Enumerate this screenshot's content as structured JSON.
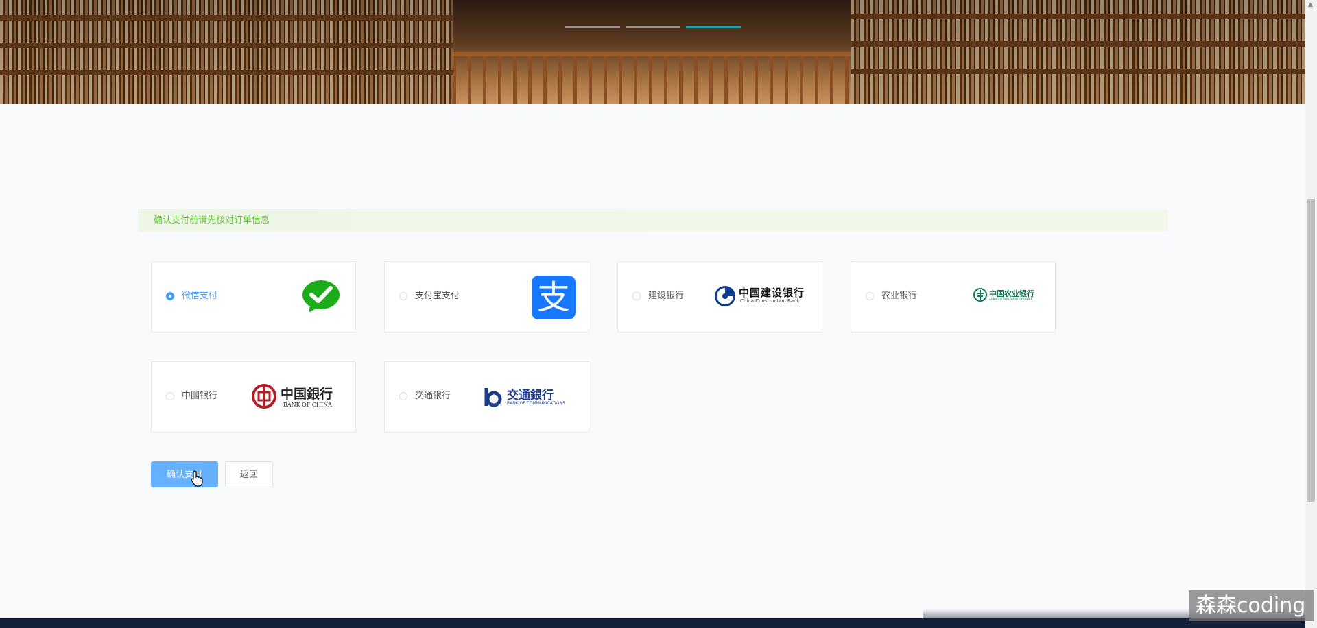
{
  "notice": {
    "text": "确认支付前请先核对订单信息"
  },
  "payment_methods": [
    {
      "label": "微信支付",
      "selected": true
    },
    {
      "label": "支付宝支付",
      "selected": false
    },
    {
      "label": "建设银行",
      "selected": false
    },
    {
      "label": "农业银行",
      "selected": false
    },
    {
      "label": "中国银行",
      "selected": false
    },
    {
      "label": "交通银行",
      "selected": false
    }
  ],
  "logos": {
    "ccb": {
      "cn": "中国建设银行",
      "en": "China Construction Bank"
    },
    "abc": {
      "cn": "中国农业银行",
      "en": "AGRICULTURAL BANK OF CHINA"
    },
    "boc": {
      "cn": "中国銀行",
      "en": "BANK OF CHINA"
    },
    "bocom": {
      "cn": "交通銀行",
      "en": "BANK OF COMMUNICATIONS"
    },
    "alipay": {
      "glyph": "支"
    }
  },
  "buttons": {
    "confirm": "确认支付",
    "back": "返回"
  },
  "watermark": "森森coding",
  "colors": {
    "primary": "#409eff",
    "primary_light": "#66b1ff",
    "notice_text": "#67c23a",
    "wechat": "#1aad19",
    "alipay": "#1677ff"
  }
}
